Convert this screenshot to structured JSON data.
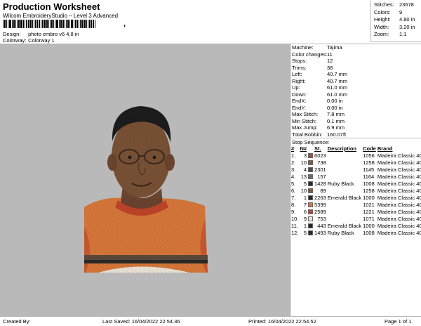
{
  "header": {
    "title": "Production Worksheet",
    "subtitle": "Wilcom EmbroideryStudio – Level 3 Advanced",
    "barcode_tail": ","
  },
  "info": {
    "design_label": "Design:",
    "design_value": "photo embro v6 4,8 in",
    "colorway_label": "Colorway:",
    "colorway_value": "Colorway 1"
  },
  "stats": [
    {
      "label": "Stitches:",
      "value": "23678"
    },
    {
      "label": "Colors:",
      "value": "9"
    },
    {
      "label": "Height:",
      "value": "4.80 in"
    },
    {
      "label": "Width:",
      "value": "3.20 in"
    },
    {
      "label": "Zoom:",
      "value": "1:1"
    }
  ],
  "machine": [
    {
      "label": "Machine:",
      "value": "Tajima"
    },
    {
      "label": "Color changes:",
      "value": "11"
    },
    {
      "label": "Stops:",
      "value": "12"
    },
    {
      "label": "Trims:",
      "value": "38"
    },
    {
      "label": "Left:",
      "value": "40.7 mm"
    },
    {
      "label": "Right:",
      "value": "40.7 mm"
    },
    {
      "label": "Up:",
      "value": "61.0 mm"
    },
    {
      "label": "Down:",
      "value": "61.0 mm"
    },
    {
      "label": "EndX:",
      "value": "0.00 in"
    },
    {
      "label": "EndY:",
      "value": "0.00 in"
    },
    {
      "label": "Max Stitch:",
      "value": "7.8 mm"
    },
    {
      "label": "Min Stitch:",
      "value": "0.1 mm"
    },
    {
      "label": "Max Jump:",
      "value": "6.9 mm"
    },
    {
      "label": "Total Bobbin:",
      "value": "160.07ft"
    }
  ],
  "sequence": {
    "heading": "Stop Sequence:",
    "columns": [
      "#",
      "N#",
      "St.",
      "Description",
      "Code",
      "Brand"
    ],
    "rows": [
      {
        "num": "1.",
        "n": "3",
        "color": "#a0522d",
        "st": "6023",
        "desc": "",
        "code": "1056",
        "brand": "Madeira Classic 40"
      },
      {
        "num": "2.",
        "n": "10",
        "color": "#8b5a3c",
        "st": "738",
        "desc": "",
        "code": "1258",
        "brand": "Madeira Classic 40"
      },
      {
        "num": "3.",
        "n": "4",
        "color": "#5c4a3a",
        "st": "2301",
        "desc": "",
        "code": "1145",
        "brand": "Madeira Classic 40"
      },
      {
        "num": "4.",
        "n": "13",
        "color": "#6b6b6b",
        "st": "157",
        "desc": "",
        "code": "1164",
        "brand": "Madeira Classic 40"
      },
      {
        "num": "5.",
        "n": "5",
        "color": "#2a2a2a",
        "st": "1428",
        "desc": "Ruby Black",
        "code": "1008",
        "brand": "Madeira Classic 40"
      },
      {
        "num": "6.",
        "n": "10",
        "color": "#8b5a3c",
        "st": "89",
        "desc": "",
        "code": "1258",
        "brand": "Madeira Classic 40"
      },
      {
        "num": "7.",
        "n": "1",
        "color": "#1f2a24",
        "st": "2263",
        "desc": "Emerald Black",
        "code": "1000",
        "brand": "Madeira Classic 40"
      },
      {
        "num": "8.",
        "n": "7",
        "color": "#d9783a",
        "st": "5399",
        "desc": "",
        "code": "1021",
        "brand": "Madeira Classic 40"
      },
      {
        "num": "9.",
        "n": "6",
        "color": "#c0452a",
        "st": "2589",
        "desc": "",
        "code": "1221",
        "brand": "Madeira Classic 40"
      },
      {
        "num": "10.",
        "n": "9",
        "color": "#ede6d8",
        "st": "753",
        "desc": "",
        "code": "1071",
        "brand": "Madeira Classic 40"
      },
      {
        "num": "11.",
        "n": "1",
        "color": "#1f2a24",
        "st": "443",
        "desc": "Emerald Black",
        "code": "1000",
        "brand": "Madeira Classic 40"
      },
      {
        "num": "12.",
        "n": "5",
        "color": "#2a2a2a",
        "st": "1493",
        "desc": "Ruby Black",
        "code": "1008",
        "brand": "Madeira Classic 40"
      }
    ]
  },
  "footer": {
    "created_by": "Created By:",
    "last_saved": "Last Saved: 16/04/2022 22.54.36",
    "printed": "Printed: 16/04/2022 22.54.52",
    "page": "Page 1 of 1"
  },
  "colors": {
    "preview_bg": "#b9b9b9",
    "shirt": "#d9783a",
    "skin": "#7a5236",
    "hair": "#1c1c1c"
  }
}
